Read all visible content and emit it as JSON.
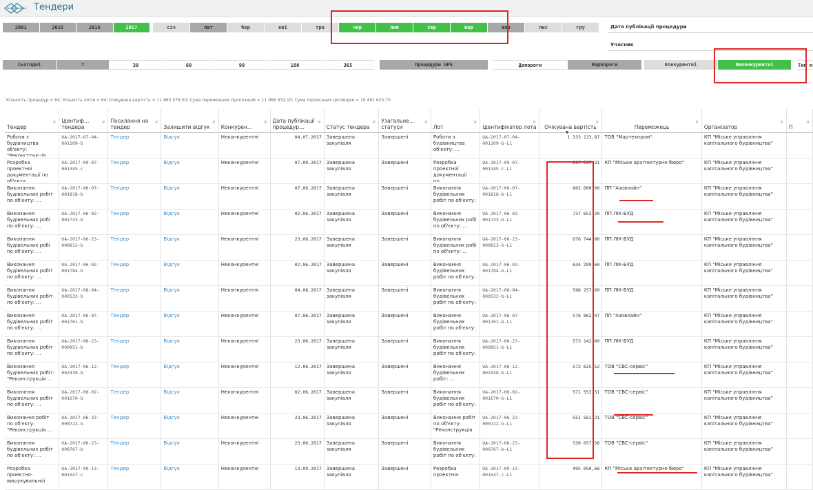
{
  "app": {
    "title": "Тендери"
  },
  "years": [
    {
      "label": "2001",
      "state": "gray"
    },
    {
      "label": "2015",
      "state": "gray"
    },
    {
      "label": "2016",
      "state": "gray"
    },
    {
      "label": "2017",
      "state": "green"
    }
  ],
  "months": [
    {
      "label": "січ",
      "state": "lgray"
    },
    {
      "label": "лют",
      "state": "gray"
    },
    {
      "label": "бер",
      "state": "lgray"
    },
    {
      "label": "кві",
      "state": "lgray"
    },
    {
      "label": "тра",
      "state": "lgray"
    },
    {
      "label": "чер",
      "state": "green"
    },
    {
      "label": "лип",
      "state": "green"
    },
    {
      "label": "сер",
      "state": "green"
    },
    {
      "label": "вер",
      "state": "green"
    },
    {
      "label": "жов",
      "state": "gray"
    },
    {
      "label": "лис",
      "state": "lgray"
    },
    {
      "label": "гру",
      "state": "lgray"
    }
  ],
  "filters": {
    "pub_date": "Дата публікації процедури",
    "participant": "Учасник",
    "type_partial": "Тип м"
  },
  "periods": [
    {
      "label": "Сьогодні",
      "state": "gray"
    },
    {
      "label": "7",
      "state": "gray"
    },
    {
      "label": "30",
      "state": "white"
    },
    {
      "label": "60",
      "state": "white"
    },
    {
      "label": "90",
      "state": "white"
    },
    {
      "label": "180",
      "state": "white"
    },
    {
      "label": "365",
      "state": "white"
    }
  ],
  "procedures": {
    "label": "Процедури GPA"
  },
  "thresholds": [
    {
      "label": "Допороги",
      "state": "white"
    },
    {
      "label": "Надпороги",
      "state": "gray"
    }
  ],
  "competition": [
    {
      "label": "Конкурентні",
      "state": "lgray"
    },
    {
      "label": "Неконкурентні",
      "state": "green"
    }
  ],
  "summary": "Кількість процедур = 64; Кількість лотів = 64; Очікувана вартість = 11 863 578,50; Сума переможних пропозицій = 11 966 932,10; Сума підписаних договорів = 10 491 625,70",
  "columns": [
    {
      "label": "Тендер",
      "search": true
    },
    {
      "label": "Ідентиф… тендера",
      "search": true
    },
    {
      "label": "Посилання на тендер",
      "search": true
    },
    {
      "label": "Залишити відгук",
      "search": true
    },
    {
      "label": "Конкурен…",
      "search": true
    },
    {
      "label": "Дата публікації процедур…",
      "search": true
    },
    {
      "label": "Статус тендера",
      "search": true
    },
    {
      "label": "Узагальне… статуси",
      "search": true
    },
    {
      "label": "Лот",
      "search": true
    },
    {
      "label": "Ідентифікатор лота",
      "search": true
    },
    {
      "label": "Очікувана вартість",
      "search": true,
      "sort": "▼"
    },
    {
      "label": "Переможець",
      "search": true
    },
    {
      "label": "Організатор",
      "search": true
    },
    {
      "label": "П",
      "search": true
    }
  ],
  "rows": [
    {
      "tender": "Роботи з будівництва об'єкту: \"Реконструкція …",
      "id": "UA-2017-07-04-001109-b",
      "link": "Тендер",
      "review": "Відгук",
      "comp": "Неконкурентні",
      "date": "04.07.2017",
      "status": "Завершена закупівля",
      "gen": "Завершені",
      "lot": "Роботи з будівництва об'єкту: …",
      "lot_id": "UA-2017-07-04-001109-b-L1",
      "value": "1 333 133,87",
      "winner": "ТОВ \"Мартехпром\"",
      "org": "КП \"Міське управління капітального будівництва\""
    },
    {
      "tender": "Розробка проектної документації по об'єкту: …",
      "id": "UA-2017-09-07-001345-c",
      "link": "Тендер",
      "review": "Відгук",
      "comp": "Неконкурентні",
      "date": "07.09.2017",
      "status": "Завершена закупівля",
      "gen": "Завершені",
      "lot": "Розробка проектної документації по…",
      "lot_id": "UA-2017-09-07-001345-c-L1",
      "value": "897 597,31",
      "winner": "КП \"Міське архітектурне бюро\"",
      "org": "КП \"Міське управління капітального будівництва\""
    },
    {
      "tender": "Виконання будівельних робіт по об'єкту: …",
      "id": "UA-2017-06-07-001818-b",
      "link": "Тендер",
      "review": "Відгук",
      "comp": "Неконкурентні",
      "date": "07.06.2017",
      "status": "Завершена закупівля",
      "gen": "Завершені",
      "lot": "Виконання будівельних робіт по об'єкту: …",
      "lot_id": "UA-2017-06-07-001818-b-L1",
      "value": "802 600,00",
      "winner": "ПП \"Азовлайн\"",
      "org": "КП \"Міське управління капітального будівництва\""
    },
    {
      "tender": "Виконання будівельних робі по об'єкту: …",
      "id": "UA-2017-06-02-001733-b",
      "link": "Тендер",
      "review": "Відгук",
      "comp": "Неконкурентні",
      "date": "02.06.2017",
      "status": "Завершена закупівля",
      "gen": "Завершені",
      "lot": "Виконання будівельних робі по об'єкту: …",
      "lot_id": "UA-2017-06-02-001733-b-L1",
      "value": "737 653,20",
      "winner": "ПП ЛІК-БУД",
      "org": "КП \"Міське управління капітального будівництва\""
    },
    {
      "tender": "Виконання будівельних робі по об'єкту: …",
      "id": "UA-2017-06-23-000813-b",
      "link": "Тендер",
      "review": "Відгук",
      "comp": "Неконкурентні",
      "date": "23.06.2017",
      "status": "Завершена закупівля",
      "gen": "Завершені",
      "lot": "Виконання будівельних робі по об'єкту: …",
      "lot_id": "UA-2017-06-23-000813-b-L1",
      "value": "676 744,80",
      "winner": "ПП ЛІК-БУД",
      "org": "КП \"Міське управління капітального будівництва\""
    },
    {
      "tender": "Виконання будівельних робіт по об'єкту: …",
      "id": "UA-2017-06-02-001784-b",
      "link": "Тендер",
      "review": "Відгук",
      "comp": "Неконкурентні",
      "date": "02.06.2017",
      "status": "Завершена закупівля",
      "gen": "Завершені",
      "lot": "Виконання будівельних робіт по об'єкту: …",
      "lot_id": "UA-2017-06-02-001784-b-L1",
      "value": "634 299,60",
      "winner": "ПП ЛІК-БУД",
      "org": "КП \"Міське управління капітального будівництва\""
    },
    {
      "tender": "Виконання будівельних робіт по об'єкту: …",
      "id": "UA-2017-08-04-000532-b",
      "link": "Тендер",
      "review": "Відгук",
      "comp": "Неконкурентні",
      "date": "04.08.2017",
      "status": "Завершена закупівля",
      "gen": "Завершені",
      "lot": "Виконання будівельних робіт по об'єкту: …",
      "lot_id": "UA-2017-08-04-000532-b-L1",
      "value": "598 257,60",
      "winner": "ПП ЛІК-БУД",
      "org": "КП \"Міське управління капітального будівництва\""
    },
    {
      "tender": "Виконання будівельних робіт по об'єкту: …",
      "id": "UA-2017-06-07-001761-b",
      "link": "Тендер",
      "review": "Відгук",
      "comp": "Неконкурентні",
      "date": "07.06.2017",
      "status": "Завершена закупівля",
      "gen": "Завершені",
      "lot": "Виконання будівельних робіт по об'єкту: …",
      "lot_id": "UA-2017-06-07-001761-b-L1",
      "value": "576 862,47",
      "winner": "ПП \"Азовлайн\"",
      "org": "КП \"Міське управління капітального будівництва\""
    },
    {
      "tender": "Виконання будівельних робіт по об'єкту: …",
      "id": "UA-2017-06-23-000851-b",
      "link": "Тендер",
      "review": "Відгук",
      "comp": "Неконкурентні",
      "date": "23.06.2017",
      "status": "Завершена закупівля",
      "gen": "Завершені",
      "lot": "Виконання будівельних робіт по об'єкту: …",
      "lot_id": "UA-2017-06-23-000851-b-L1",
      "value": "573 142,80",
      "winner": "ПП ЛІК-БУД",
      "org": "КП \"Міське управління капітального будівництва\""
    },
    {
      "tender": "Виконання будівельних робіт: \"Реконструкція …",
      "id": "UA-2017-06-12-002438-b",
      "link": "Тендер",
      "review": "Відгук",
      "comp": "Неконкурентні",
      "date": "12.06.2017",
      "status": "Завершена закупівля",
      "gen": "Завершені",
      "lot": "Виконання будівельних робіт: …",
      "lot_id": "UA-2017-06-12-002438-b-L1",
      "value": "572 625,52",
      "winner": "ТОВ \"СВС-сервіс\"",
      "org": "КП \"Міське управління капітального будівництва\""
    },
    {
      "tender": "Виконання будівельних робіт по об'єкту: …",
      "id": "UA-2017-06-02-001670-b",
      "link": "Тендер",
      "review": "Відгук",
      "comp": "Неконкурентні",
      "date": "02.06.2017",
      "status": "Завершена закупівля",
      "gen": "Завершені",
      "lot": "Виконання будівельних робіт по об'єкту: …",
      "lot_id": "UA-2017-06-02-001670-b-L1",
      "value": "571 553,51",
      "winner": "ТОВ \"СВС-сервіс\"",
      "org": "КП \"Міське управління капітального будівництва\""
    },
    {
      "tender": "Виконання робіт по об'єкту: \"Реконструкція …",
      "id": "UA-2017-06-23-000722-b",
      "link": "Тендер",
      "review": "Відгук",
      "comp": "Неконкурентні",
      "date": "23.06.2017",
      "status": "Завершена закупівля",
      "gen": "Завершені",
      "lot": "Виконання робіт по об'єкту: \"Реконструкція …",
      "lot_id": "UA-2017-06-23-000722-b-L1",
      "value": "551 561,21",
      "winner": "ТОВ \"СВС-сервіс\"",
      "org": "КП \"Міське управління капітального будівництва\""
    },
    {
      "tender": "Виконання будівельних робіт по об'єкту: …",
      "id": "UA-2017-06-23-000767-b",
      "link": "Тендер",
      "review": "Відгук",
      "comp": "Неконкурентні",
      "date": "23.06.2017",
      "status": "Завершена закупівля",
      "gen": "Завершені",
      "lot": "Виконання будівельних робіт по об'єкту: …",
      "lot_id": "UA-2017-06-23-000767-b-L1",
      "value": "530 057,56",
      "winner": "ТОВ \"СВС-сервіс\"",
      "org": "КП \"Міське управління капітального будівництва\""
    },
    {
      "tender": "Розробка проектно-вишукувальної",
      "id": "UA-2017-09-13-001547-c",
      "link": "Тендер",
      "review": "Відгук",
      "comp": "Неконкурентні",
      "date": "13.09.2017",
      "status": "Завершена закупівля",
      "gen": "Завершені",
      "lot": "Розробка проектно-",
      "lot_id": "UA-2017-09-13-001547-c-L1",
      "value": "495 050,68",
      "winner": "КП \"Міське архітектурне бюро\"",
      "org": "КП \"Міське управління капітального будівництва\""
    }
  ]
}
